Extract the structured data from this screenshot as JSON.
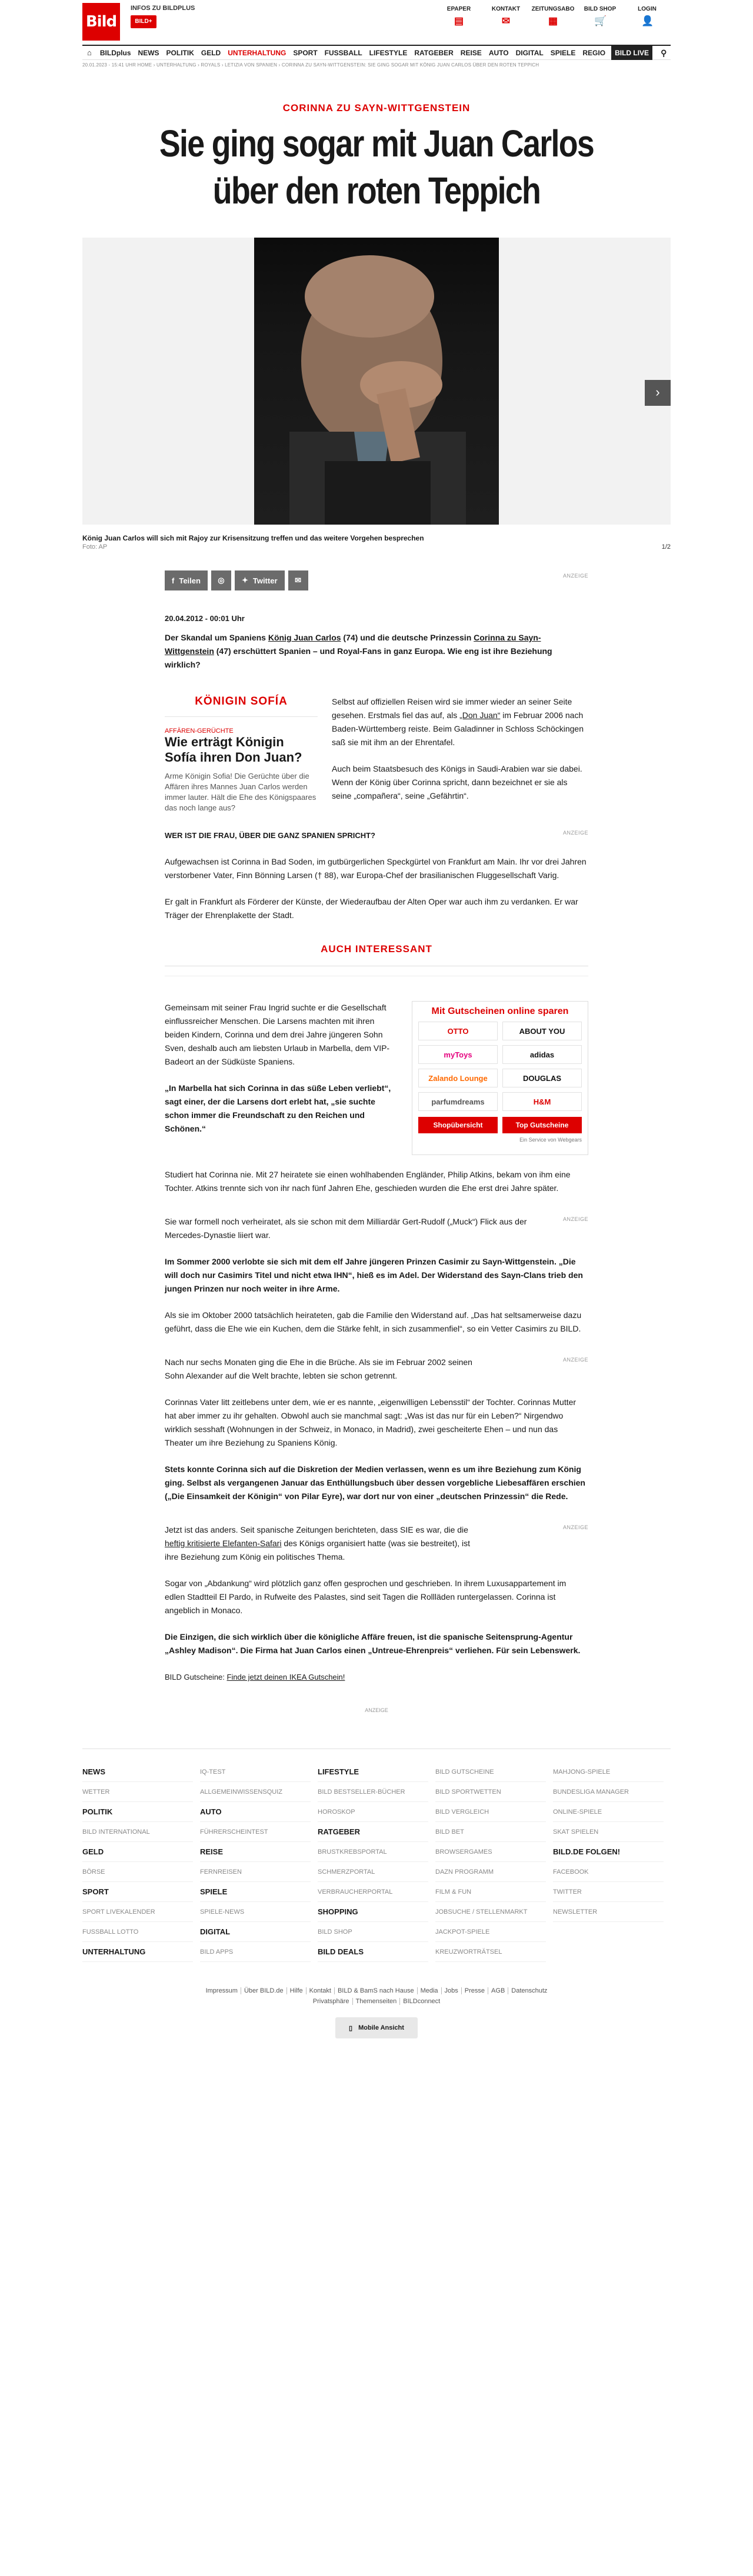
{
  "header": {
    "logo": "Bild",
    "plus_info": "INFOS ZU BILDPLUS",
    "plus_badge": "BILD+",
    "services": [
      {
        "label": "EPAPER",
        "icon": "epaper-icon",
        "glyph": "▤"
      },
      {
        "label": "KONTAKT",
        "icon": "mail-icon",
        "glyph": "✉"
      },
      {
        "label": "ZEITUNGSABO",
        "icon": "newspaper-icon",
        "glyph": "▦"
      },
      {
        "label": "BILD SHOP",
        "icon": "cart-icon",
        "glyph": "🛒"
      },
      {
        "label": "LOGIN",
        "icon": "user-icon",
        "glyph": "👤"
      }
    ]
  },
  "nav": {
    "home_icon": "⌂",
    "items": [
      "BILDplus",
      "NEWS",
      "POLITIK",
      "GELD",
      "UNTERHALTUNG",
      "SPORT",
      "FUSSBALL",
      "LIFESTYLE",
      "RATGEBER",
      "REISE",
      "AUTO",
      "DIGITAL",
      "SPIELE",
      "REGIO"
    ],
    "live": "BILD LIVE",
    "search_icon": "⚲"
  },
  "breadcrumb": "20.01.2023 - 15:41 Uhr   HOME › UNTERHALTUNG › ROYALS › LETIZIA VON SPANIEN › CORINNA ZU SAYN-WITTGENSTEIN: SIE GING SOGAR MIT KÖNIG JUAN CARLOS ÜBER DEN ROTEN TEPPICH",
  "article": {
    "kicker": "CORINNA ZU SAYN-WITTGENSTEIN",
    "title": "Sie ging sogar mit Juan Carlos über den roten Teppich",
    "gallery": {
      "caption": "König Juan Carlos will sich mit Rajoy zur Krisensitzung treffen und das weitere Vorgehen besprechen",
      "credit": "Foto: AP",
      "counter": "1/2",
      "next_icon": "›"
    },
    "share": {
      "facebook": "Teilen",
      "twitter": "Twitter",
      "ad": "ANZEIGE"
    },
    "date": "20.04.2012 - 00:01 Uhr",
    "lead_a": "Der Skandal um Spaniens ",
    "lead_link1": "König Juan Carlos",
    "lead_b": " (74) und die deutsche Prinzessin ",
    "lead_link2": "Corinna zu Sayn-Wittgenstein",
    "lead_c": " (47) erschüttert Spanien – und Royal-Fans in ganz Europa. Wie eng ist ihre Beziehung wirklich?",
    "sidebar": {
      "heading": "KÖNIGIN SOFÍA",
      "kicker": "AFFÄREN-GERÜCHTE",
      "title": "Wie erträgt Königin Sofía ihren Don Juan?",
      "teaser": "Arme Königin Sofia! Die Gerüchte über die Affären ihres Mannes Juan Carlos werden immer lauter. Hält die Ehe des Königspaares das noch lange aus?"
    },
    "p1_a": "Selbst auf offiziellen Reisen wird sie immer wieder an seiner Seite gesehen. Erstmals fiel das auf, als ",
    "p1_link": "„Don Juan“",
    "p1_b": " im Februar 2006 nach Baden-Württemberg reiste. Beim Galadinner in Schloss Schöckingen saß sie mit ihm an der Ehrentafel.",
    "p2": "Auch beim Staatsbesuch des Königs in Saudi-Arabien war sie dabei. Wenn der König über Corinna spricht, dann bezeichnet er sie als seine „compañera“, seine „Gefährtin“.",
    "q1": "WER IST DIE FRAU, ÜBER DIE GANZ SPANIEN SPRICHT?",
    "p3": "Aufgewachsen ist Corinna in Bad Soden, im gutbürgerlichen Speckgürtel von Frankfurt am Main. Ihr vor drei Jahren verstorbener Vater, Finn Bönning Larsen († 88), war Europa-Chef der brasilianischen Fluggesellschaft Varig.",
    "p4": "Er galt in Frankfurt als Förderer der Künste, der Wiederaufbau der Alten Oper war auch ihm zu verdanken. Er war Träger der Ehrenplakette der Stadt.",
    "also": "AUCH INTERESSANT",
    "p5": "Gemeinsam mit seiner Frau Ingrid suchte er die Gesellschaft einflussreicher Menschen. Die Larsens machten mit ihren beiden Kindern, Corinna und dem drei Jahre jüngeren Sohn Sven, deshalb auch am liebsten Urlaub in Marbella, dem VIP-Badeort an der Südküste Spaniens.",
    "p6": "„In Marbella hat sich Corinna in das süße Leben verliebt“, sagt einer, der die Larsens dort erlebt hat, „sie suchte schon immer die Freundschaft zu den Reichen und Schönen.“",
    "p7": "Studiert hat Corinna nie. Mit 27 heiratete sie einen wohlhabenden Engländer, Philip Atkins, bekam von ihm eine Tochter. Atkins trennte sich von ihr nach fünf Jahren Ehe, geschieden wurden die Ehe erst drei Jahre später.",
    "p8": "Sie war formell noch verheiratet, als sie schon mit dem Milliardär Gert-Rudolf („Muck“) Flick aus der Mercedes-Dynastie liiert war.",
    "p9": "Im Sommer 2000 verlobte sie sich mit dem elf Jahre jüngeren Prinzen Casimir zu Sayn-Wittgenstein. „Die will doch nur Casimirs Titel und nicht etwa IHN“, hieß es im Adel. Der Widerstand des Sayn-Clans trieb den jungen Prinzen nur noch weiter in ihre Arme.",
    "p10": "Als sie im Oktober 2000 tatsächlich heirateten, gab die Familie den Widerstand auf. „Das hat seltsamerweise dazu geführt, dass die Ehe wie ein Kuchen, dem die Stärke fehlt, in sich zusammenfiel“, so ein Vetter Casimirs zu BILD.",
    "p11": "Nach nur sechs Monaten ging die Ehe in die Brüche. Als sie im Februar 2002 seinen Sohn Alexander auf die Welt brachte, lebten sie schon getrennt.",
    "p12": "Corinnas Vater litt zeitlebens unter dem, wie er es nannte, „eigenwilligen Lebensstil“ der Tochter. Corinnas Mutter hat aber immer zu ihr gehalten. Obwohl auch sie manchmal sagt: „Was ist das nur für ein Leben?“ Nirgendwo wirklich sesshaft (Wohnungen in der Schweiz, in Monaco, in Madrid), zwei gescheiterte Ehen – und nun das Theater um ihre Beziehung zu Spaniens König.",
    "p13": "Stets konnte Corinna sich auf die Diskretion der Medien verlassen, wenn es um ihre Beziehung zum König ging. Selbst als vergangenen Januar das Enthüllungsbuch über dessen vorgebliche Liebesaffären erschien („Die Einsamkeit der Königin“ von Pilar Eyre), war dort nur von einer „deutschen Prinzessin“ die Rede.",
    "p14_a": "Jetzt ist das anders. Seit spanische Zeitungen berichteten, dass SIE es war, die die ",
    "p14_link": "heftig kritisierte Elefanten-Safari",
    "p14_b": " des Königs organisiert hatte (was sie bestreitet), ist ihre Beziehung zum König ein politisches Thema.",
    "p15": "Sogar von „Abdankung“ wird plötzlich ganz offen gesprochen und geschrieben. In ihrem Luxusappartement im edlen Stadtteil El Pardo, in Rufweite des Palastes, sind seit Tagen die Rollläden runtergelassen. Corinna ist angeblich in Monaco.",
    "p16": "Die Einzigen, die sich wirklich über die königliche Affäre freuen, ist die spanische Seitensprung-Agentur „Ashley Madison“. Die Firma hat Juan Carlos einen „Untreue-Ehrenpreis“ verliehen. Für sein Lebenswerk.",
    "gutschein_a": "BILD Gutscheine: ",
    "gutschein_link": "Finde jetzt deinen IKEA Gutschein!",
    "ad": "ANZEIGE"
  },
  "voucher": {
    "title": "Mit Gutscheinen online sparen",
    "tiles": [
      {
        "label": "OTTO",
        "color": "#d00"
      },
      {
        "label": "ABOUT YOU",
        "color": "#111"
      },
      {
        "label": "myToys",
        "color": "#e5007e"
      },
      {
        "label": "adidas",
        "color": "#111"
      },
      {
        "label": "Zalando Lounge",
        "color": "#ff6900"
      },
      {
        "label": "DOUGLAS",
        "color": "#111"
      },
      {
        "label": "parfumdreams",
        "color": "#555"
      },
      {
        "label": "H&M",
        "color": "#d00"
      }
    ],
    "btn1": "Shopübersicht",
    "btn2": "Top Gutscheine",
    "foot": "Ein Service von Webgears"
  },
  "footer": {
    "rows": [
      [
        {
          "t": "NEWS",
          "b": true
        },
        {
          "t": "IQ-TEST",
          "b": false
        },
        {
          "t": "LIFESTYLE",
          "b": true
        },
        {
          "t": "BILD GUTSCHEINE",
          "b": false
        },
        {
          "t": "MAHJONG-SPIELE",
          "b": false
        }
      ],
      [
        {
          "t": "WETTER",
          "b": false
        },
        {
          "t": "ALLGEMEINWISSENSQUIZ",
          "b": false
        },
        {
          "t": "BILD BESTSELLER-BÜCHER",
          "b": false
        },
        {
          "t": "BILD SPORTWETTEN",
          "b": false
        },
        {
          "t": "BUNDESLIGA MANAGER",
          "b": false
        }
      ],
      [
        {
          "t": "POLITIK",
          "b": true
        },
        {
          "t": "AUTO",
          "b": true
        },
        {
          "t": "HOROSKOP",
          "b": false
        },
        {
          "t": "BILD VERGLEICH",
          "b": false
        },
        {
          "t": "ONLINE-SPIELE",
          "b": false
        }
      ],
      [
        {
          "t": "BILD INTERNATIONAL",
          "b": false
        },
        {
          "t": "FÜHRERSCHEINTEST",
          "b": false
        },
        {
          "t": "RATGEBER",
          "b": true
        },
        {
          "t": "BILD BET",
          "b": false
        },
        {
          "t": "SKAT SPIELEN",
          "b": false
        }
      ],
      [
        {
          "t": "GELD",
          "b": true
        },
        {
          "t": "REISE",
          "b": true
        },
        {
          "t": "BRUSTKREBSPORTAL",
          "b": false
        },
        {
          "t": "BROWSERGAMES",
          "b": false
        },
        {
          "t": "BILD.DE FOLGEN!",
          "b": true
        }
      ],
      [
        {
          "t": "BÖRSE",
          "b": false
        },
        {
          "t": "FERNREISEN",
          "b": false
        },
        {
          "t": "SCHMERZPORTAL",
          "b": false
        },
        {
          "t": "DAZN PROGRAMM",
          "b": false
        },
        {
          "t": "FACEBOOK",
          "b": false
        }
      ],
      [
        {
          "t": "SPORT",
          "b": true
        },
        {
          "t": "SPIELE",
          "b": true
        },
        {
          "t": "VERBRAUCHERPORTAL",
          "b": false
        },
        {
          "t": "FILM & FUN",
          "b": false
        },
        {
          "t": "TWITTER",
          "b": false
        }
      ],
      [
        {
          "t": "SPORT LIVEKALENDER",
          "b": false
        },
        {
          "t": "SPIELE-NEWS",
          "b": false
        },
        {
          "t": "SHOPPING",
          "b": true
        },
        {
          "t": "JOBSUCHE / STELLENMARKT",
          "b": false
        },
        {
          "t": "NEWSLETTER",
          "b": false
        }
      ],
      [
        {
          "t": "FUSSBALL LOTTO",
          "b": false
        },
        {
          "t": "DIGITAL",
          "b": true
        },
        {
          "t": "BILD SHOP",
          "b": false
        },
        {
          "t": "JACKPOT-SPIELE",
          "b": false
        },
        {
          "t": "",
          "b": false
        }
      ],
      [
        {
          "t": "UNTERHALTUNG",
          "b": true
        },
        {
          "t": "BILD APPS",
          "b": false
        },
        {
          "t": "BILD DEALS",
          "b": true
        },
        {
          "t": "KREUZWORTRÄTSEL",
          "b": false
        },
        {
          "t": "",
          "b": false
        }
      ]
    ],
    "links": [
      "Impressum",
      "Über BILD.de",
      "Hilfe",
      "Kontakt",
      "BILD & BamS nach Hause",
      "Media",
      "Jobs",
      "Presse",
      "AGB",
      "Datenschutz"
    ],
    "links2": [
      "Privatsphäre",
      "Themenseiten",
      "BILDconnect"
    ],
    "mobile": "Mobile Ansicht",
    "mobile_icon": "▯"
  }
}
